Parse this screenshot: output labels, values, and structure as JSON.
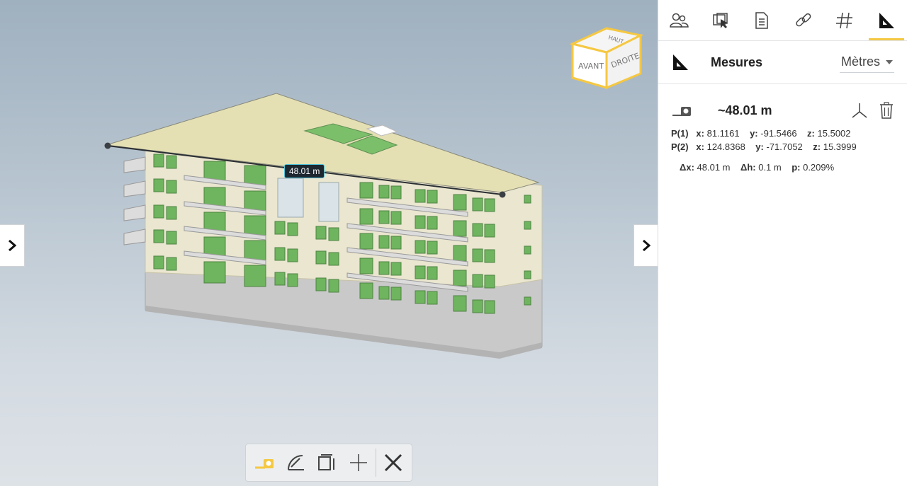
{
  "viewport": {
    "measurement_label": "48.01 m",
    "viewcube": {
      "top": "HAUT",
      "front": "AVANT",
      "right": "DROITE"
    }
  },
  "panel": {
    "tabs": [
      {
        "icon": "people-icon"
      },
      {
        "icon": "select-icon"
      },
      {
        "icon": "checklist-icon"
      },
      {
        "icon": "link-icon"
      },
      {
        "icon": "hash-icon"
      },
      {
        "icon": "set-square-icon",
        "active": true
      }
    ],
    "title": "Mesures",
    "unit": "Mètres",
    "measurement": {
      "value": "~48.01 m",
      "p1": {
        "label": "P(1)",
        "x_label": "x:",
        "x": "81.1161",
        "y_label": "y:",
        "y": "-91.5466",
        "z_label": "z:",
        "z": "15.5002"
      },
      "p2": {
        "label": "P(2)",
        "x_label": "x:",
        "x": "124.8368",
        "y_label": "y:",
        "y": "-71.7052",
        "z_label": "z:",
        "z": "15.3999"
      },
      "deltas": {
        "dx_label": "Δx:",
        "dx": "48.01 m",
        "dh_label": "Δh:",
        "dh": "0.1 m",
        "p_label": "p:",
        "p": "0.209%"
      }
    }
  },
  "colors": {
    "accent": "#f5c842",
    "label_bg": "#1d2730",
    "label_border": "#4fc3d9"
  }
}
